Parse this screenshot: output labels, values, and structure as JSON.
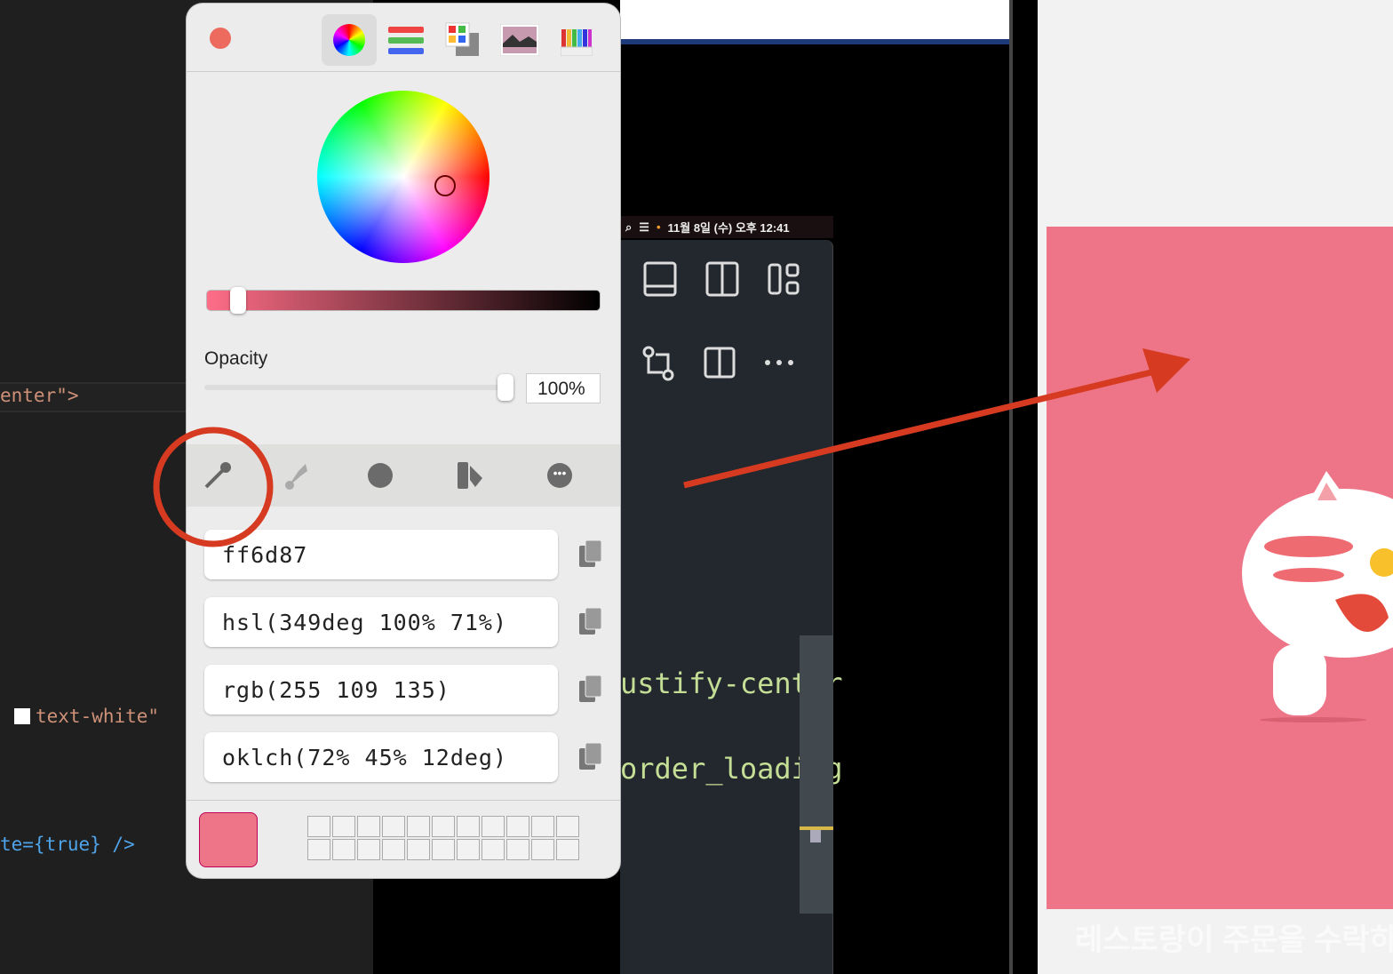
{
  "editor": {
    "lines": [
      "enter\">",
      "text-white\"",
      "te={true} />"
    ]
  },
  "inner_screen": {
    "menubar_datetime": "11월 8일 (수) 오후 12:41",
    "code_lines": [
      "ustify-center",
      "order_loading"
    ]
  },
  "color_panel": {
    "tabs": [
      "color-wheel",
      "color-sliders",
      "color-palettes",
      "image-palettes",
      "pencils"
    ],
    "opacity_label": "Opacity",
    "opacity_value": "100%",
    "opacity_fraction": 1.0,
    "brightness_fraction": 0.08,
    "tools": [
      "eyedropper",
      "brush",
      "history",
      "swatches",
      "more"
    ],
    "formats": [
      {
        "value": "ff6d87"
      },
      {
        "value": "hsl(349deg 100% 71%)"
      },
      {
        "value": "rgb(255 109 135)"
      },
      {
        "value": "oklch(72% 45% 12deg)"
      }
    ],
    "current_color": "#ee7587"
  },
  "preview": {
    "caption": "레스토랑이 주문을 수락하"
  },
  "colors": {
    "accent": "#ff6d87",
    "annotation": "#d63b22"
  }
}
